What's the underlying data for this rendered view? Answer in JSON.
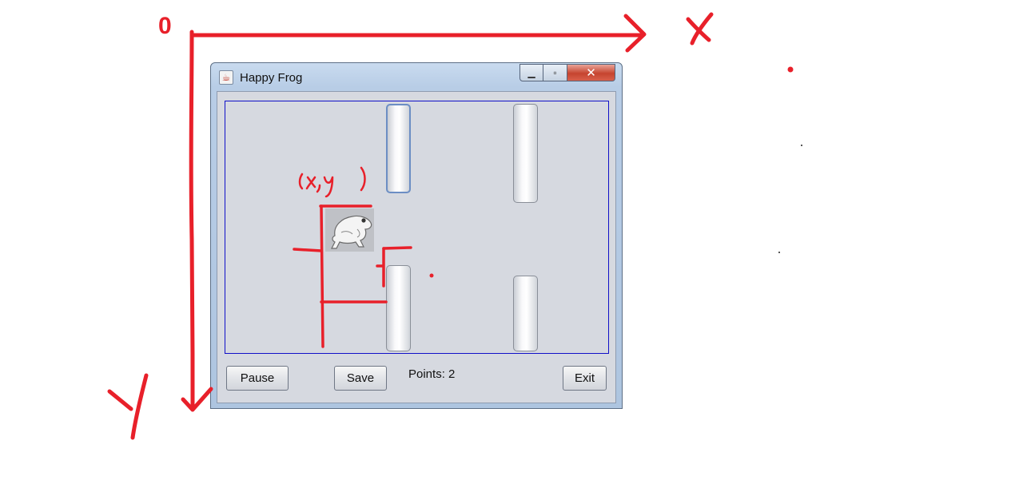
{
  "annotation": {
    "origin_label": "0",
    "point_label": "(x,y)",
    "color": "#e8202a"
  },
  "window": {
    "title": "Happy Frog",
    "controls": {
      "minimize_icon": "minimize-icon",
      "maximize_icon": "maximize-icon",
      "close_icon": "close-icon"
    }
  },
  "game": {
    "pipes": [
      "top-pipe-1",
      "top-pipe-2",
      "bottom-pipe-1",
      "bottom-pipe-2"
    ],
    "frog_icon": "frog-sprite"
  },
  "toolbar": {
    "pause_label": "Pause",
    "save_label": "Save",
    "points_text": "Points: 2",
    "exit_label": "Exit"
  }
}
